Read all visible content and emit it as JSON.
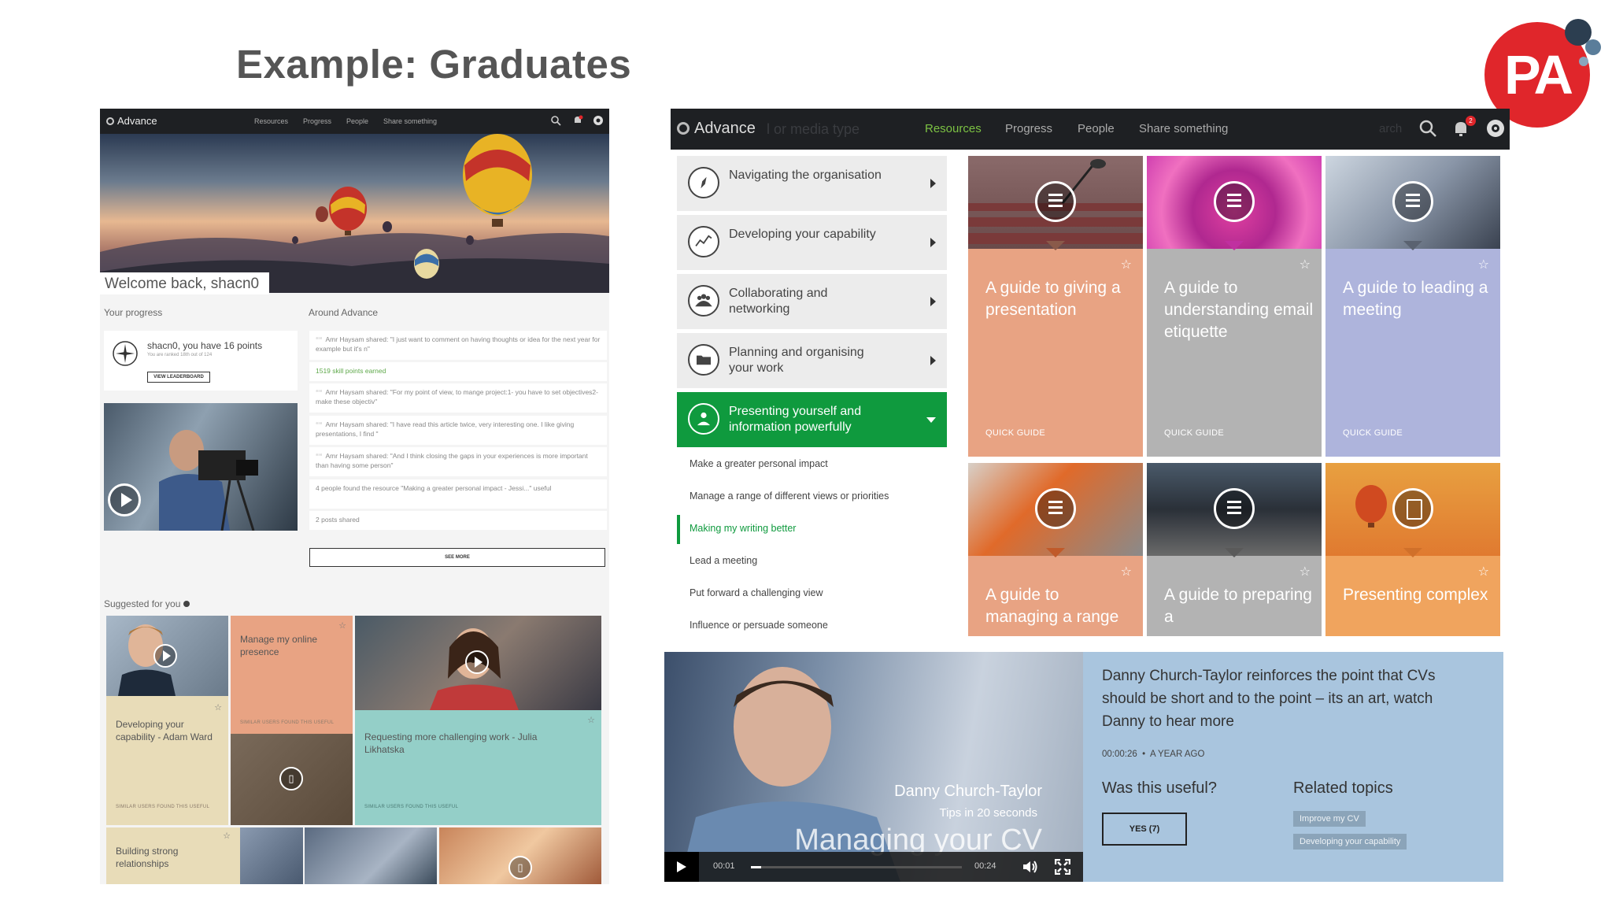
{
  "slide": {
    "title": "Example: Graduates",
    "logo_text": "PA"
  },
  "colors": {
    "accent_green": "#0f9a3e",
    "nav_dark": "#1e2023",
    "pa_red": "#e0262b",
    "tile_salmon": "#e8a383",
    "tile_grey": "#b3b3b3",
    "tile_lavender": "#aeb4dc",
    "tile_orange": "#f0a45e",
    "video_info_blue": "#a9c5de"
  },
  "left_screen": {
    "nav": {
      "brand": "Advance",
      "links": [
        "Resources",
        "Progress",
        "People",
        "Share something"
      ],
      "icons": [
        "search-icon",
        "bell-icon",
        "profile-icon"
      ]
    },
    "welcome": "Welcome back, shacn0",
    "progress": {
      "label": "Your progress",
      "points_text": "shacn0, you have 16 points",
      "rank_text": "You are ranked 18th out of 124",
      "button": "VIEW LEADERBOARD"
    },
    "feed": {
      "label": "Around Advance",
      "items": [
        "Amr Haysam shared: \"I just want to comment on having thoughts or idea for the next year for example but it's n\"",
        "1519 skill points earned",
        "Amr Haysam shared: \"For my point of view, to mange project:1- you have to set objectives2- make these objectiv\"",
        "Amr Haysam shared: \"I have read this article twice, very interesting one. I like giving presentations, I find \"",
        "Amr Haysam shared: \"And I think closing the gaps in your experiences is more important than having some person\"",
        "4 people found the resource \"Making a greater personal impact - Jessi...\" useful",
        "2 posts shared"
      ],
      "see_more": "SEE MORE"
    },
    "suggested": {
      "label": "Suggested for you",
      "tiles": [
        {
          "title": "Developing your capability - Adam Ward",
          "footer": "SIMILAR USERS FOUND THIS USEFUL"
        },
        {
          "title": "Manage my online presence",
          "footer": "SIMILAR USERS FOUND THIS USEFUL"
        },
        {
          "title": "Requesting more challenging work - Julia Likhatska",
          "footer": "SIMILAR USERS FOUND THIS USEFUL"
        },
        {
          "title": "Building strong relationships",
          "footer": ""
        }
      ]
    }
  },
  "right_screen": {
    "nav": {
      "brand": "Advance",
      "ghost_text": "l  or  media type",
      "links": [
        {
          "label": "Resources",
          "active": true
        },
        {
          "label": "Progress",
          "active": false
        },
        {
          "label": "People",
          "active": false
        },
        {
          "label": "Share something",
          "active": false
        }
      ],
      "ghost_right": "arch",
      "notification_count": "2",
      "icons": [
        "search-icon",
        "bell-icon",
        "profile-icon"
      ]
    },
    "menu": [
      {
        "label": "Navigating the organisation",
        "icon": "compass-icon",
        "active": false
      },
      {
        "label": "Developing your capability",
        "icon": "chart-line-icon",
        "active": false
      },
      {
        "label": "Collaborating and networking",
        "icon": "people-icon",
        "active": false
      },
      {
        "label": "Planning and organising your work",
        "icon": "folder-icon",
        "active": false
      },
      {
        "label": "Presenting yourself and information powerfully",
        "icon": "person-icon",
        "active": true
      }
    ],
    "submenu": [
      {
        "label": "Make a greater personal impact",
        "current": false
      },
      {
        "label": "Manage a range of different views or priorities",
        "current": false
      },
      {
        "label": "Making my writing better",
        "current": true
      },
      {
        "label": "Lead a meeting",
        "current": false
      },
      {
        "label": "Put forward a challenging view",
        "current": false
      },
      {
        "label": "Influence or persuade someone",
        "current": false
      }
    ],
    "guides": [
      {
        "title": "A guide to giving a presentation",
        "footer": "QUICK GUIDE"
      },
      {
        "title": "A guide to understanding email etiquette",
        "footer": "QUICK GUIDE"
      },
      {
        "title": "A guide to leading a meeting",
        "footer": "QUICK GUIDE"
      },
      {
        "title": "A guide to managing a range",
        "footer": ""
      },
      {
        "title": "A guide to preparing a",
        "footer": ""
      },
      {
        "title": "Presenting complex",
        "footer": ""
      }
    ],
    "video": {
      "name": "Danny Church-Taylor",
      "series": "Tips in 20 seconds",
      "title": "Managing your CV",
      "time_current": "00:01",
      "time_total": "00:24",
      "progress": 0.05
    },
    "video_info": {
      "description": "Danny Church-Taylor reinforces the point that CVs should be short and to the point – its an art, watch Danny to hear more",
      "duration": "00:00:26",
      "age": "A YEAR AGO",
      "useful_label": "Was this useful?",
      "yes_button": "YES (7)",
      "related_label": "Related topics",
      "related_tags": [
        "Improve my CV",
        "Developing your capability"
      ]
    }
  }
}
